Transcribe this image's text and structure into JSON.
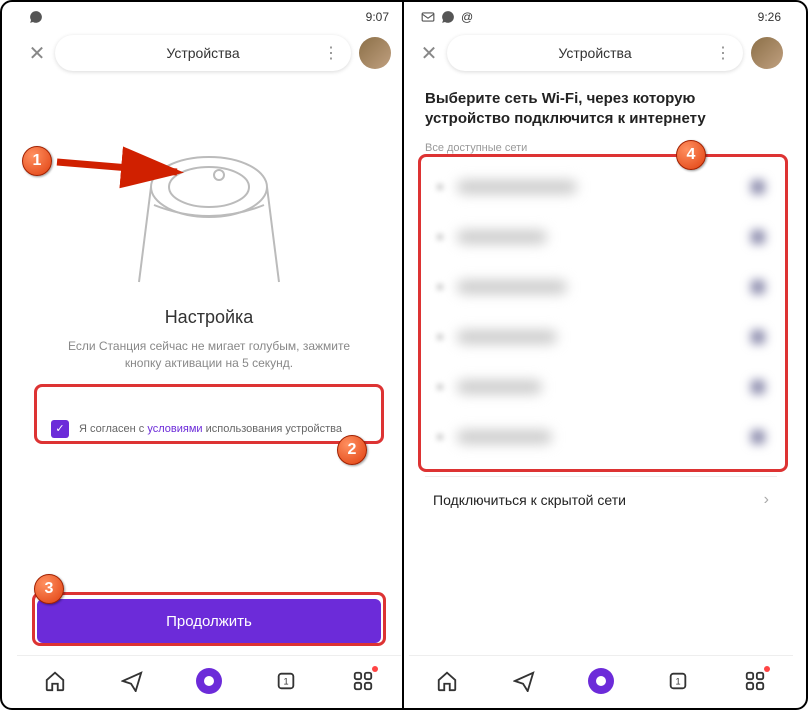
{
  "left": {
    "status": {
      "time": "9:07"
    },
    "header": {
      "title": "Устройства"
    },
    "setup": {
      "title": "Настройка",
      "desc": "Если Станция сейчас не мигает голубым, зажмите кнопку активации на 5 секунд."
    },
    "terms": {
      "prefix": "Я согласен с ",
      "link": "условиями",
      "suffix": " использования устройства"
    },
    "continue_label": "Продолжить"
  },
  "right": {
    "status": {
      "time": "9:26"
    },
    "header": {
      "title": "Устройства"
    },
    "wifi": {
      "heading": "Выберите сеть Wi-Fi, через которую устройство подключится к интернету",
      "subhead": "Все доступные сети",
      "hidden": "Подключиться к скрытой сети"
    }
  },
  "badges": {
    "b1": "1",
    "b2": "2",
    "b3": "3",
    "b4": "4"
  },
  "colors": {
    "accent": "#6c2bd9",
    "callout": "#d33"
  }
}
